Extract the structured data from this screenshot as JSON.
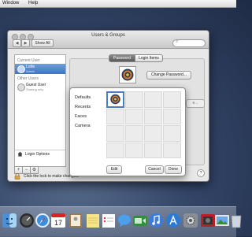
{
  "menubar": {
    "items": [
      "Window",
      "Help"
    ]
  },
  "window": {
    "title": "Users & Groups",
    "show_all_label": "Show All",
    "back_glyph": "◀",
    "forward_glyph": "▶",
    "search_glyph": "⌕"
  },
  "sidebar": {
    "current_user_label": "Current User",
    "current_user": {
      "name": "Lotte",
      "role": "Admin"
    },
    "other_users_label": "Other Users",
    "guest_user": {
      "name": "Guest User",
      "role": "Sharing only"
    },
    "login_options_label": "Login Options",
    "add_glyph": "+",
    "remove_glyph": "−",
    "action_glyph": "⚙"
  },
  "lock": {
    "text": "Click the lock to make changes."
  },
  "tabs": {
    "password": "Password",
    "login_items": "Login Items"
  },
  "pane": {
    "change_password_label": "Change Password...",
    "ghost_button_label": "e..."
  },
  "popover": {
    "categories": [
      "Defaults",
      "Recents",
      "Faces",
      "Camera"
    ],
    "edit_label": "Edit",
    "cancel_label": "Cancel",
    "done_label": "Done"
  },
  "help": {
    "glyph": "?"
  },
  "colors": {
    "selection": "#4b7cc4",
    "desktop": "#35476a"
  },
  "dock": {
    "icons": [
      "finder-icon",
      "dashboard-icon",
      "safari-icon",
      "calendar-icon",
      "contacts-icon",
      "notes-icon",
      "reminders-icon",
      "messages-icon",
      "facetime-icon",
      "itunes-icon",
      "app-store-icon",
      "system-preferences-icon",
      "photo-booth-icon",
      "iphoto-icon",
      "trash-icon"
    ],
    "calendar_day": "17"
  }
}
